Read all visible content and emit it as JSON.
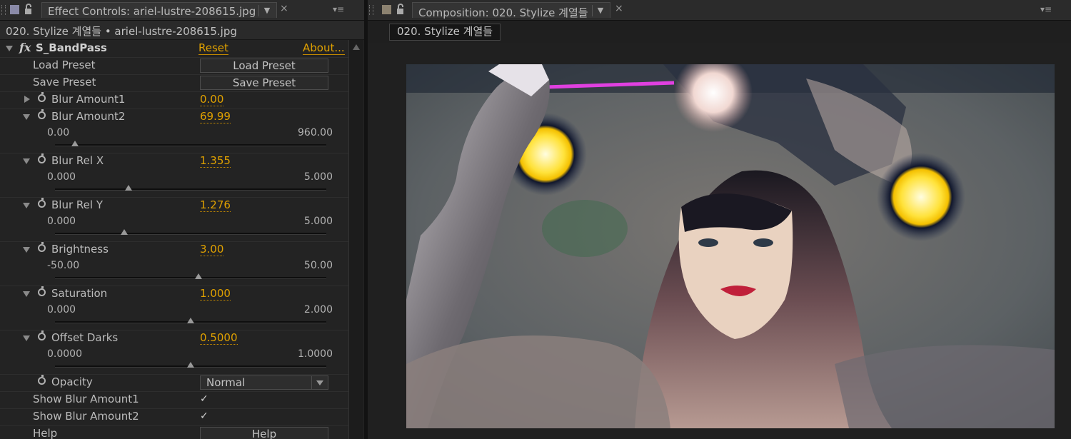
{
  "left_panel": {
    "tab_title": "Effect Controls: ariel-lustre-208615.jpg",
    "close": "×",
    "menu": "▾≡",
    "breadcrumb": "020. Stylize 계열들 • ariel-lustre-208615.jpg",
    "effect": {
      "fx_symbol": "fx",
      "name": "S_BandPass",
      "reset_label": "Reset",
      "about_label": "About..."
    },
    "load_preset": {
      "label": "Load Preset",
      "button": "Load Preset"
    },
    "save_preset": {
      "label": "Save Preset",
      "button": "Save Preset"
    },
    "blur_amount1": {
      "label": "Blur Amount1",
      "value": "0.00"
    },
    "sliders": [
      {
        "label": "Blur Amount2",
        "value": "69.99",
        "min": "0.00",
        "max": "960.00",
        "fraction": 0.073
      },
      {
        "label": "Blur Rel X",
        "value": "1.355",
        "min": "0.000",
        "max": "5.000",
        "fraction": 0.271
      },
      {
        "label": "Blur Rel Y",
        "value": "1.276",
        "min": "0.000",
        "max": "5.000",
        "fraction": 0.255
      },
      {
        "label": "Brightness",
        "value": "3.00",
        "min": "-50.00",
        "max": "50.00",
        "fraction": 0.53
      },
      {
        "label": "Saturation",
        "value": "1.000",
        "min": "0.000",
        "max": "2.000",
        "fraction": 0.5
      },
      {
        "label": "Offset Darks",
        "value": "0.5000",
        "min": "0.0000",
        "max": "1.0000",
        "fraction": 0.5
      }
    ],
    "opacity": {
      "label": "Opacity",
      "value": "Normal"
    },
    "show_blur_amount1": {
      "label": "Show Blur Amount1",
      "checked": "✓"
    },
    "show_blur_amount2": {
      "label": "Show Blur Amount2",
      "checked": "✓"
    },
    "help": {
      "label": "Help",
      "button": "Help"
    }
  },
  "right_panel": {
    "tab_title": "Composition: 020. Stylize 계열들",
    "close": "×",
    "menu": "▾≡",
    "comp_tab": "020. Stylize 계열들"
  },
  "colors": {
    "value_orange": "#e0a100",
    "panel_bg": "#232323",
    "effect_swatch": "#8a8aa8",
    "comp_swatch": "#8c8270"
  }
}
